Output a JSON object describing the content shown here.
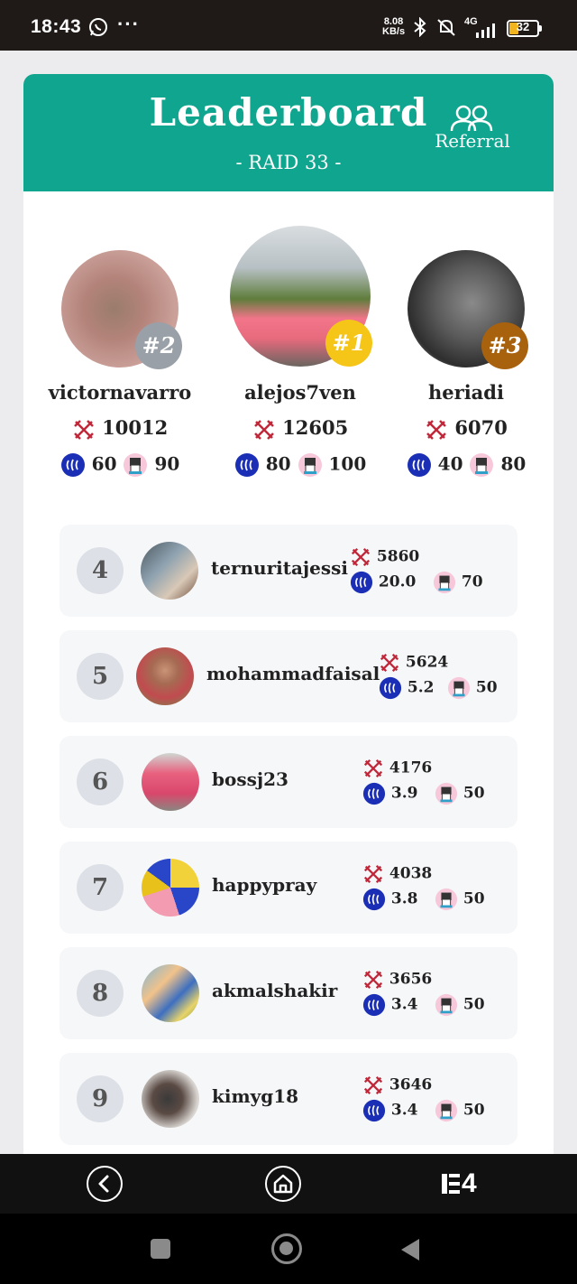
{
  "status_bar": {
    "time": "18:43",
    "more": "···",
    "net_speed": "8.08",
    "net_unit": "KB/s",
    "signal": "4G",
    "battery": "32",
    "icons": [
      "whatsapp-icon",
      "bluetooth-icon",
      "mute-bell-icon",
      "signal-icon",
      "battery-icon"
    ]
  },
  "header": {
    "title": "Leaderboard",
    "subtitle": "- RAID 33 -",
    "referral_label": "Referral",
    "color": "#0fa58e"
  },
  "podium": [
    {
      "rank": "#2",
      "name": "victornavarro",
      "score": "10012",
      "steem": "60",
      "token": "90",
      "badge_color": "#9aa0a8"
    },
    {
      "rank": "#1",
      "name": "alejos7ven",
      "score": "12605",
      "steem": "80",
      "token": "100",
      "badge_color": "#f5c518"
    },
    {
      "rank": "#3",
      "name": "heriadi",
      "score": "6070",
      "steem": "40",
      "token": "80",
      "badge_color": "#a8620e"
    }
  ],
  "rows": [
    {
      "rank": "4",
      "name": "ternuritajessi",
      "score": "5860",
      "steem": "20.0",
      "token": "70"
    },
    {
      "rank": "5",
      "name": "mohammadfaisal",
      "score": "5624",
      "steem": "5.2",
      "token": "50"
    },
    {
      "rank": "6",
      "name": "bossj23",
      "score": "4176",
      "steem": "3.9",
      "token": "50"
    },
    {
      "rank": "7",
      "name": "happypray",
      "score": "4038",
      "steem": "3.8",
      "token": "50"
    },
    {
      "rank": "8",
      "name": "akmalshakir",
      "score": "3656",
      "steem": "3.4",
      "token": "50"
    },
    {
      "rank": "9",
      "name": "kimyg18",
      "score": "3646",
      "steem": "3.4",
      "token": "50"
    }
  ],
  "app_nav": {
    "back_icon": "chevron-left-icon",
    "home_icon": "home-icon",
    "logo_text": "4"
  },
  "colors": {
    "sword": "#c0283a",
    "steem": "#1a2fb5",
    "row_bg": "#f6f7f9"
  }
}
